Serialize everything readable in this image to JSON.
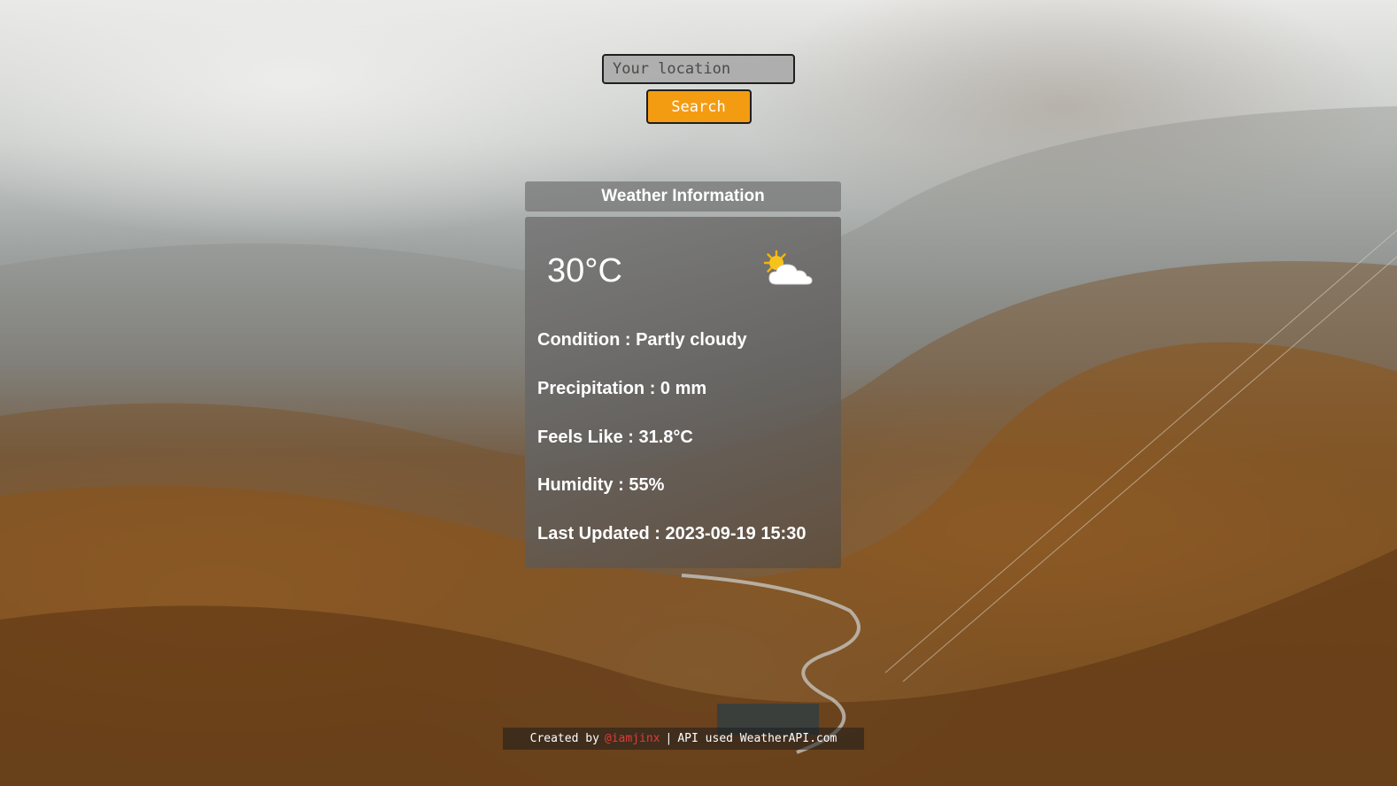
{
  "search": {
    "placeholder": "Your location",
    "button_label": "Search"
  },
  "weather": {
    "header_title": "Weather Information",
    "temperature": "30°C",
    "condition_icon": "partly-cloudy-icon",
    "rows": [
      "Condition : Partly cloudy",
      "Precipitation : 0 mm",
      "Feels Like : 31.8°C",
      "Humidity : 55%",
      "Last Updated : 2023-09-19 15:30"
    ]
  },
  "footer": {
    "created_prefix": "Created by",
    "author_link": "@iamjinx",
    "separator": "|",
    "api_text": "API used WeatherAPI.com"
  },
  "colors": {
    "accent_button": "#f39c12",
    "author_link": "#e23b3b"
  }
}
